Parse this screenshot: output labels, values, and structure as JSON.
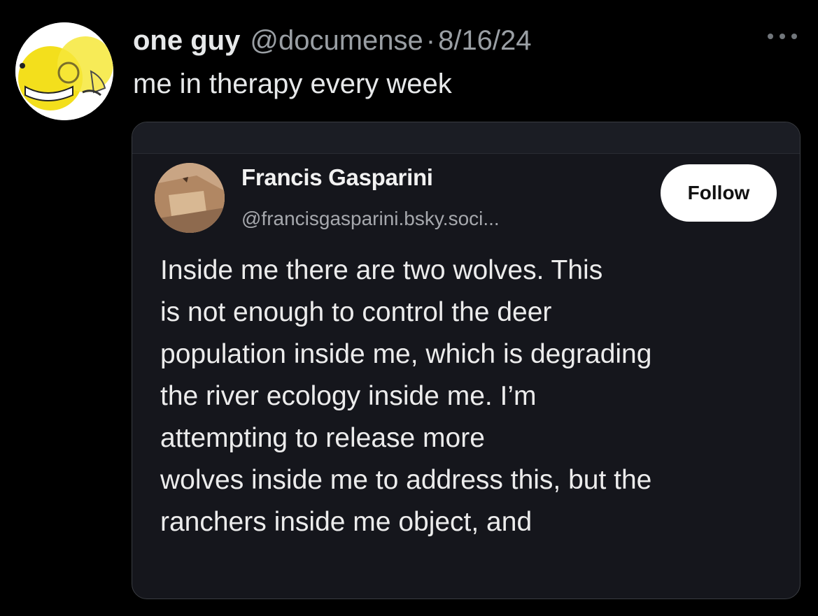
{
  "tweet": {
    "display_name": "one guy",
    "handle": "@documense",
    "separator": "·",
    "date": "8/16/24",
    "text": "me in therapy every week",
    "more_icon": "more-horizontal-icon",
    "avatar_icon": "smiley-face-avatar"
  },
  "embedded_post": {
    "author_name": "Francis Gasparini",
    "author_handle": "@francisgasparini.bsky.soci...",
    "follow_label": "Follow",
    "lines": [
      "Inside me there are two wolves. This",
      "is not enough to control the deer",
      "population inside me, which is degrading",
      "the river ecology inside me. I’m",
      "attempting to release more",
      "wolves inside me to address this, but the",
      "ranchers inside me object, and"
    ]
  },
  "colors": {
    "background": "#000000",
    "text_primary": "#e7e9ea",
    "text_secondary": "#9a9fa4",
    "card_background": "#15161c",
    "follow_button": "#ffffff",
    "avatar_yellow": "#f5e21a"
  }
}
